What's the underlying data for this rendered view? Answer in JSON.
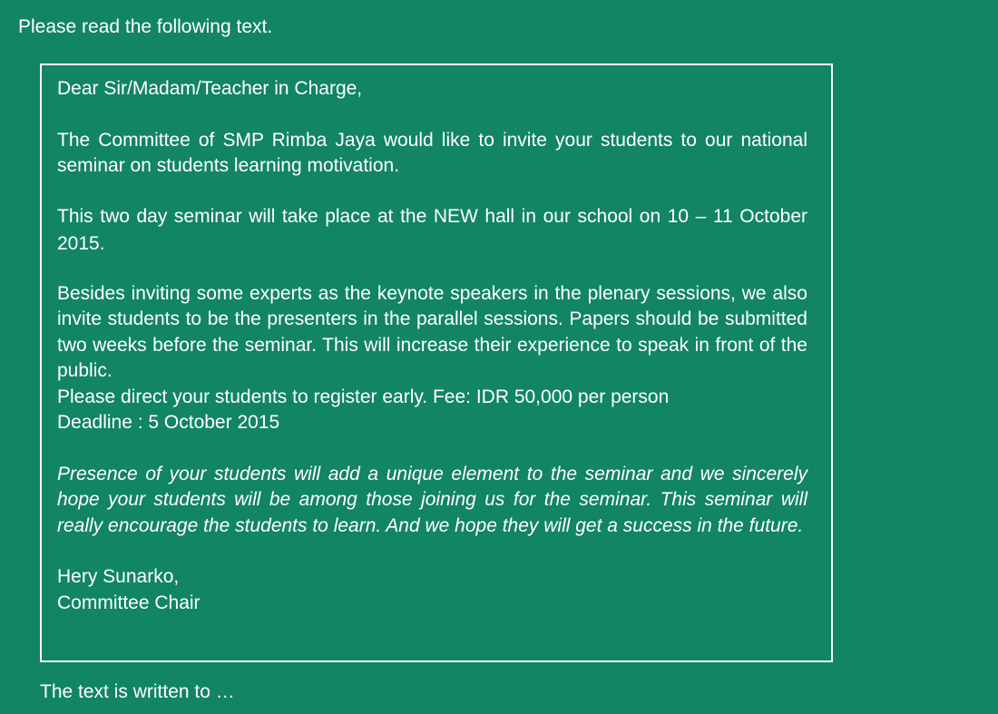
{
  "instruction": "Please read the following text.",
  "letter": {
    "salutation": "Dear Sir/Madam/Teacher in Charge,",
    "paragraph1": "The Committee of SMP Rimba Jaya would like to invite your students to our national seminar on students learning motivation.",
    "paragraph2": "This two day seminar will take place at the NEW hall in our school on 10 – 11 October 2015.",
    "paragraph3": "Besides inviting some experts as the keynote speakers in the plenary sessions, we also invite students to be the presenters in the parallel sessions. Papers should be submitted two weeks before the seminar. This will increase their experience to speak in front of the public.",
    "register_line": "Please direct your students to register early. Fee: IDR 50,000 per person",
    "deadline_line": "Deadline : 5 October 2015",
    "closing_paragraph": "Presence of your students will add a unique element to the seminar and we sincerely hope your students will be among those joining us for the seminar. This seminar will really encourage the students to learn. And we hope they will get a success in the future.",
    "signature_name": "Hery Sunarko,",
    "signature_title": "Committee Chair"
  },
  "question": "The text is written to …"
}
